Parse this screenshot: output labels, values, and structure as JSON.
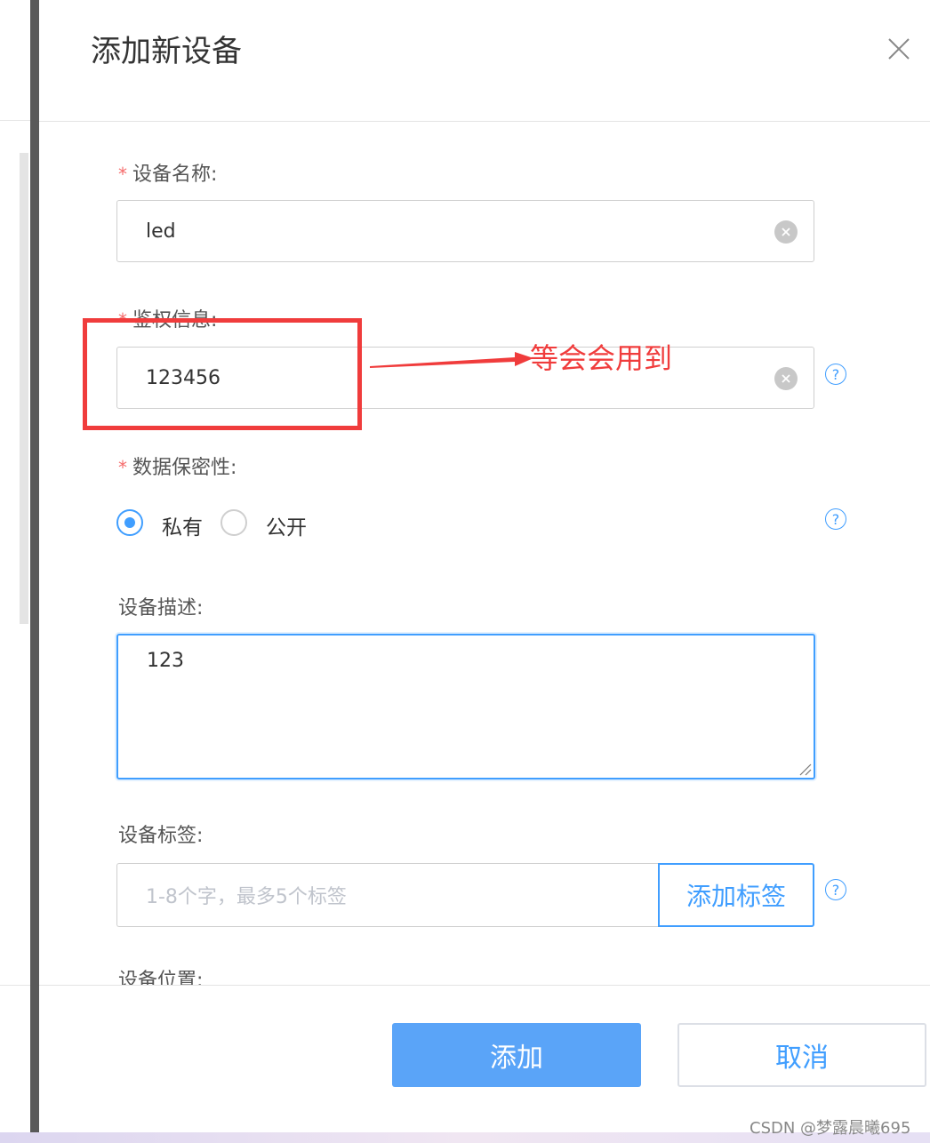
{
  "dialog": {
    "title": "添加新设备"
  },
  "form": {
    "device_name": {
      "label": "设备名称:",
      "value": "led"
    },
    "auth_info": {
      "label": "鉴权信息:",
      "value": "123456"
    },
    "privacy": {
      "label": "数据保密性:",
      "options": [
        "私有",
        "公开"
      ],
      "selected": "私有"
    },
    "description": {
      "label": "设备描述:",
      "value": "123"
    },
    "tags": {
      "label": "设备标签:",
      "placeholder": "1-8个字，最多5个标签",
      "add_button": "添加标签"
    },
    "location": {
      "label": "设备位置:"
    }
  },
  "footer": {
    "confirm": "添加",
    "cancel": "取消"
  },
  "annotation": {
    "text": "等会会用到",
    "color": "#f03c3c"
  },
  "watermark": "CSDN @梦露晨曦695",
  "colors": {
    "primary": "#409eff",
    "required": "#f56c6c",
    "annotation": "#f03c3c"
  },
  "icons": {
    "close": "close-icon",
    "clear": "clear-icon",
    "help": "help-icon"
  }
}
